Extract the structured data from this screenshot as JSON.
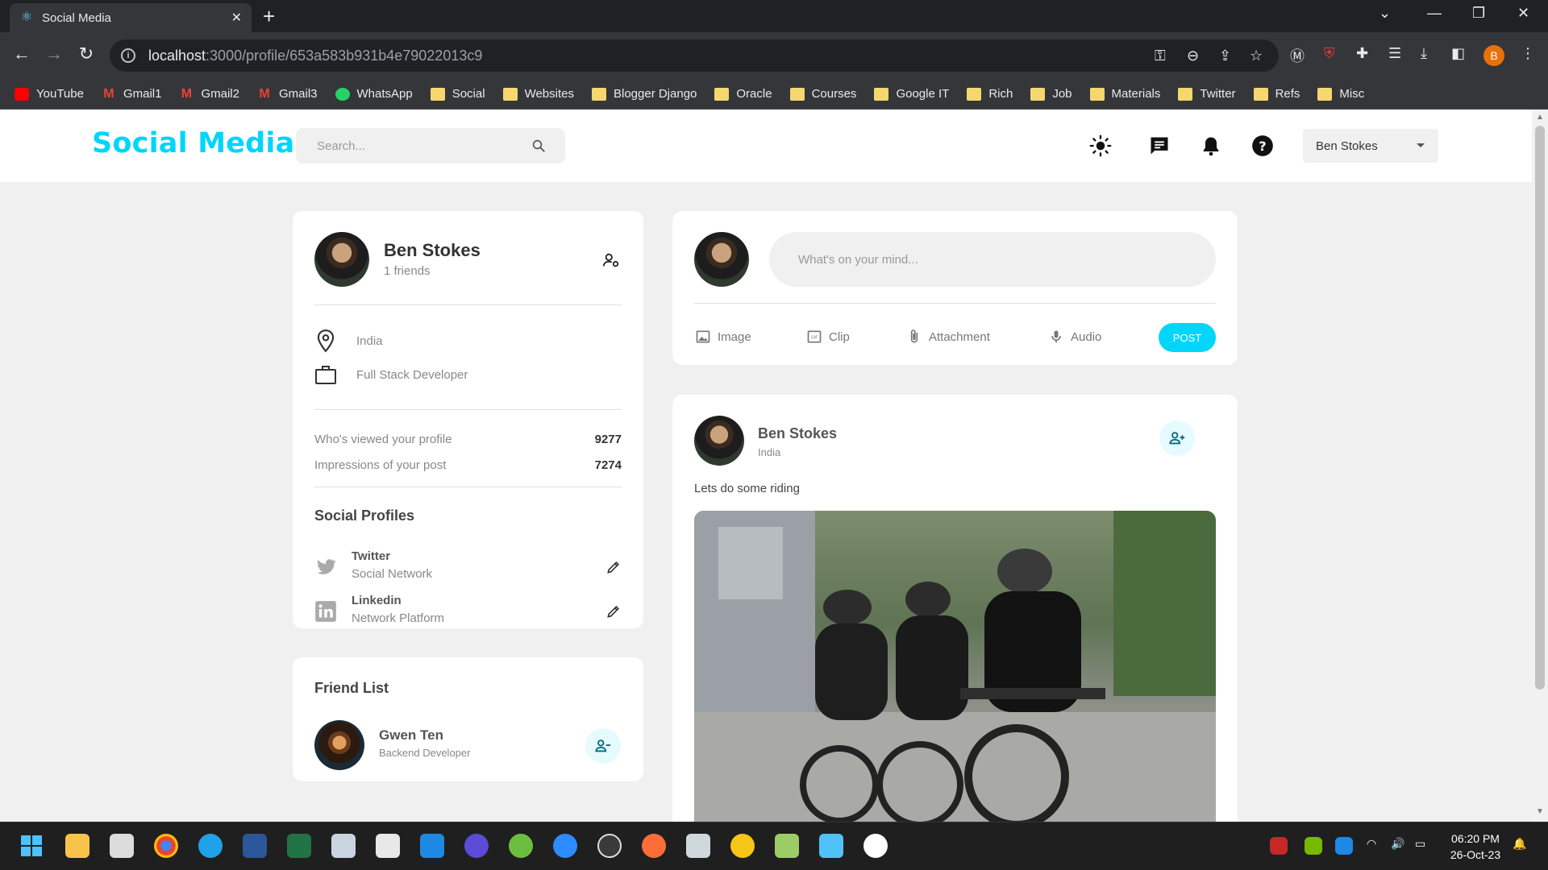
{
  "browser": {
    "tab_title": "Social Media",
    "url_host": "localhost",
    "url_path": ":3000/profile/653a583b931b4e79022013c9",
    "profile_initial": "B",
    "bookmarks": [
      "YouTube",
      "Gmail1",
      "Gmail2",
      "Gmail3",
      "WhatsApp",
      "Social",
      "Websites",
      "Blogger Django",
      "Oracle",
      "Courses",
      "Google IT",
      "Rich",
      "Job",
      "Materials",
      "Twitter",
      "Refs",
      "Misc"
    ]
  },
  "navbar": {
    "brand": "Social Media",
    "search_placeholder": "Search...",
    "user_name": "Ben Stokes"
  },
  "profile": {
    "name": "Ben Stokes",
    "friends": "1 friends",
    "location": "India",
    "occupation": "Full Stack Developer",
    "stats": [
      {
        "label": "Who's viewed your profile",
        "value": "9277"
      },
      {
        "label": "Impressions of your post",
        "value": "7274"
      }
    ],
    "social_title": "Social Profiles",
    "socials": [
      {
        "name": "Twitter",
        "sub": "Social Network"
      },
      {
        "name": "Linkedin",
        "sub": "Network Platform"
      }
    ]
  },
  "friend_list": {
    "title": "Friend List",
    "friends": [
      {
        "name": "Gwen Ten",
        "role": "Backend Developer"
      }
    ]
  },
  "compose": {
    "placeholder": "What's on your mind...",
    "actions": [
      "Image",
      "Clip",
      "Attachment",
      "Audio"
    ],
    "post_label": "POST"
  },
  "post": {
    "author": "Ben Stokes",
    "location": "India",
    "text": "Lets do some riding"
  },
  "taskbar": {
    "time": "06:20 PM",
    "date": "26-Oct-23"
  },
  "colors": {
    "brand": "#00d5fa",
    "accent_light": "#e6fbff",
    "page_bg": "#f0f0f0"
  }
}
